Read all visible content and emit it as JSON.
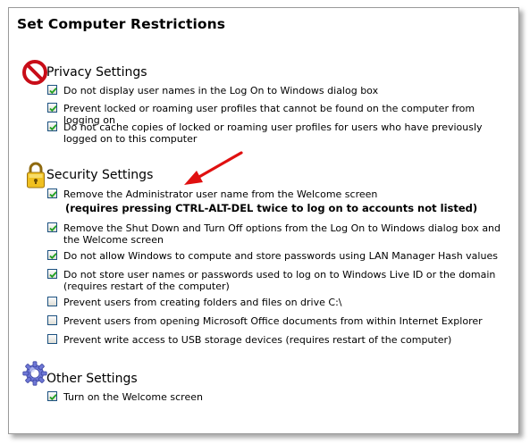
{
  "title": "Set Computer Restrictions",
  "sections": {
    "privacy": {
      "heading": "Privacy Settings",
      "icon": "no-entry-icon",
      "items": [
        {
          "label": "Do not display user names in the Log On to Windows dialog box",
          "checked": true
        },
        {
          "label": "Prevent locked or roaming user profiles that cannot be found on the computer from logging on",
          "checked": true
        },
        {
          "label": "Do not cache copies of locked or roaming user profiles for users who have previously logged on to this computer",
          "checked": true
        }
      ]
    },
    "security": {
      "heading": "Security Settings",
      "icon": "padlock-icon",
      "note": "(requires pressing CTRL-ALT-DEL twice to log on to accounts not listed)",
      "items": [
        {
          "label": "Remove the Administrator user name from the Welcome screen",
          "checked": true
        },
        {
          "label": "Remove the Shut Down and Turn Off options from the Log On to Windows dialog box and the Welcome screen",
          "checked": true
        },
        {
          "label": "Do not allow Windows to compute and store passwords using LAN Manager Hash values",
          "checked": true
        },
        {
          "label": "Do not store user names or passwords used to log on to Windows Live ID or the domain (requires restart of the computer)",
          "checked": true
        },
        {
          "label": "Prevent users from creating folders and files on drive C:\\",
          "checked": false
        },
        {
          "label": "Prevent users from opening Microsoft Office documents from within Internet Explorer",
          "checked": false
        },
        {
          "label": "Prevent write access to USB storage devices (requires restart of the computer)",
          "checked": false
        }
      ]
    },
    "other": {
      "heading": "Other Settings",
      "icon": "gear-icon",
      "items": [
        {
          "label": "Turn on the Welcome screen",
          "checked": true
        }
      ]
    }
  },
  "colors": {
    "arrow": "#e01010",
    "checkbox_border": "#1c5180",
    "checkmark": "#21a121",
    "no_entry_red": "#d8101a"
  }
}
